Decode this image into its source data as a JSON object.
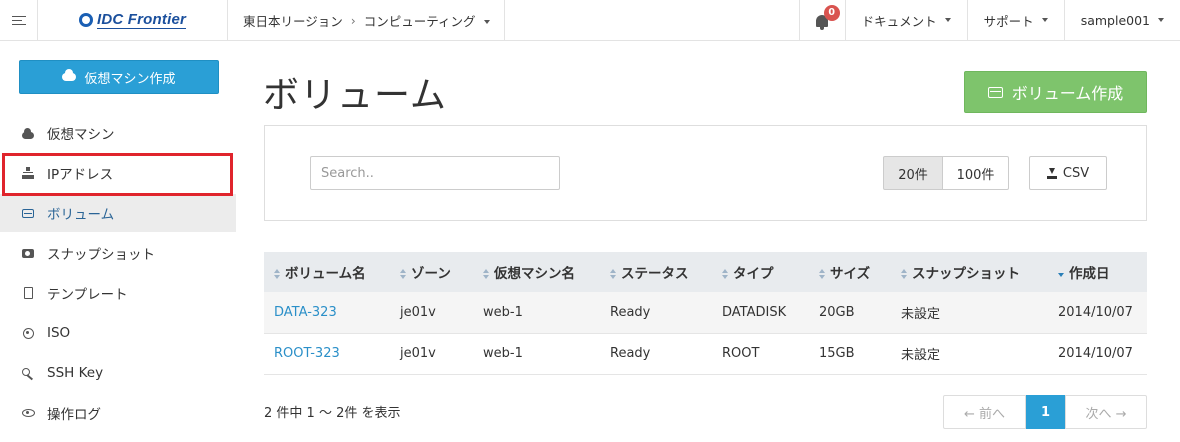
{
  "topbar": {
    "logo_text": "IDC Frontier",
    "region": "東日本リージョン",
    "breadcrumb_sep": "›",
    "service": "コンピューティング",
    "notification_count": "0",
    "menus": [
      "ドキュメント",
      "サポート",
      "sample001"
    ]
  },
  "sidebar": {
    "create_vm_label": "仮想マシン作成",
    "items": [
      {
        "label": "仮想マシン",
        "icon": "cloud-icon"
      },
      {
        "label": "IPアドレス",
        "icon": "network-icon"
      },
      {
        "label": "ボリューム",
        "icon": "hdd-icon"
      },
      {
        "label": "スナップショット",
        "icon": "camera-icon"
      },
      {
        "label": "テンプレート",
        "icon": "file-icon"
      },
      {
        "label": "ISO",
        "icon": "disc-icon"
      },
      {
        "label": "SSH Key",
        "icon": "key-icon"
      },
      {
        "label": "操作ログ",
        "icon": "eye-icon"
      }
    ],
    "active_index": 2
  },
  "main": {
    "title": "ボリューム",
    "create_volume_label": "ボリューム作成",
    "search_placeholder": "Search..",
    "page_size_options": [
      "20件",
      "100件"
    ],
    "selected_page_size": "20件",
    "csv_label": "CSV",
    "table": {
      "columns": [
        "ボリューム名",
        "ゾーン",
        "仮想マシン名",
        "ステータス",
        "タイプ",
        "サイズ",
        "スナップショット",
        "作成日"
      ],
      "rows": [
        [
          "DATA-323",
          "je01v",
          "web-1",
          "Ready",
          "DATADISK",
          "20GB",
          "未設定",
          "2014/10/07"
        ],
        [
          "ROOT-323",
          "je01v",
          "web-1",
          "Ready",
          "ROOT",
          "15GB",
          "未設定",
          "2014/10/07"
        ]
      ]
    },
    "summary": "2 件中 1 〜 2件 を表示",
    "pagination": {
      "prev": "← 前へ",
      "current": "1",
      "next": "次へ →"
    }
  },
  "colors": {
    "primary": "#2a9fd6",
    "success": "#7ec46c",
    "highlight": "#e0242c",
    "badge": "#d9534f"
  }
}
